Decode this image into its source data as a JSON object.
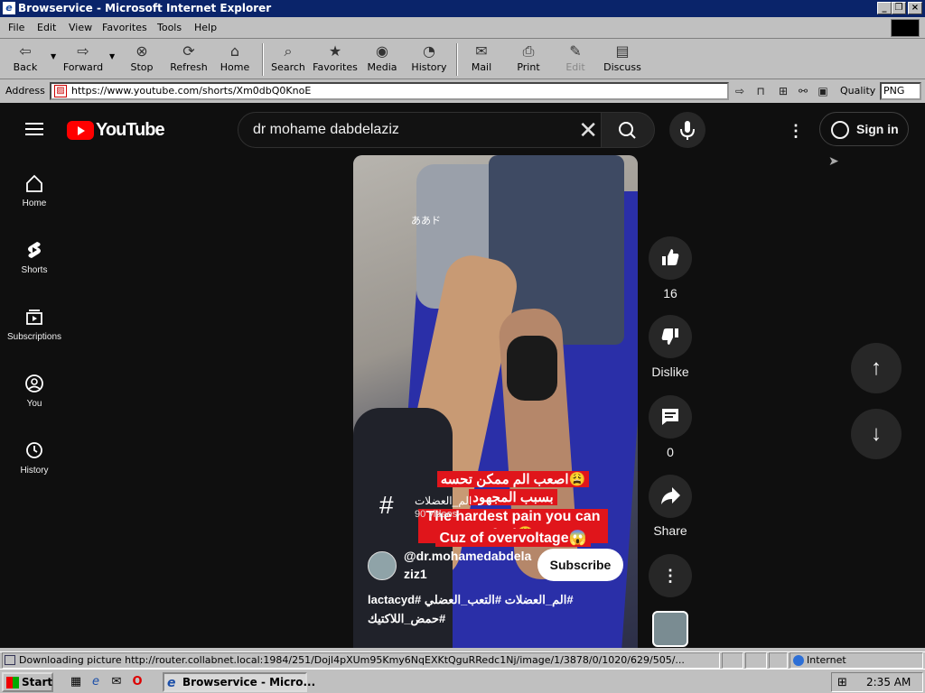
{
  "window": {
    "title": "Browservice - Microsoft Internet Explorer"
  },
  "menu": [
    "File",
    "Edit",
    "View",
    "Favorites",
    "Tools",
    "Help"
  ],
  "toolbar": {
    "back": "Back",
    "forward": "Forward",
    "stop": "Stop",
    "refresh": "Refresh",
    "home": "Home",
    "search": "Search",
    "favorites": "Favorites",
    "media": "Media",
    "history": "History",
    "mail": "Mail",
    "print": "Print",
    "edit": "Edit",
    "discuss": "Discuss"
  },
  "address": {
    "label": "Address",
    "url": "https://www.youtube.com/shorts/Xm0dbQ0KnoE",
    "quality_label": "Quality",
    "quality_value": "PNG"
  },
  "youtube": {
    "logo_text": "YouTube",
    "search_value": "dr mohame dabdelaziz",
    "sign_in": "Sign in",
    "nav": [
      "Home",
      "Shorts",
      "Subscriptions",
      "You",
      "History"
    ],
    "jp_badge": "ああド",
    "overlay_lines": [
      "اصعب الم ممكن تحسه😩",
      "بسبب المجهود",
      "The hardest pain you can feel😩",
      "Cuz of overvoltage😱"
    ],
    "hashtag_name": "الم_العضلات",
    "hashtag_count": "90 videos",
    "channel": "@dr.mohamedabdelaziz1",
    "channel_line1": "@dr.mohamedabdela",
    "channel_line2": "ziz1",
    "subscribe": "Subscribe",
    "description_line1": "#الم_العضلات #التعب_العضلي #lactacyd",
    "description_line2": "#حمض_اللاكتيك",
    "likes": "16",
    "dislike_label": "Dislike",
    "comments": "0",
    "share_label": "Share"
  },
  "status": {
    "text": "Downloading picture http://router.collabnet.local:1984/251/Dojl4pXUm95Kmy6NqEXKtQguRRedc1Nj/image/1/3878/0/1020/629/505/...",
    "zone": "Internet"
  },
  "taskbar": {
    "start": "Start",
    "task": "Browservice - Micro...",
    "clock": "2:35 AM"
  }
}
